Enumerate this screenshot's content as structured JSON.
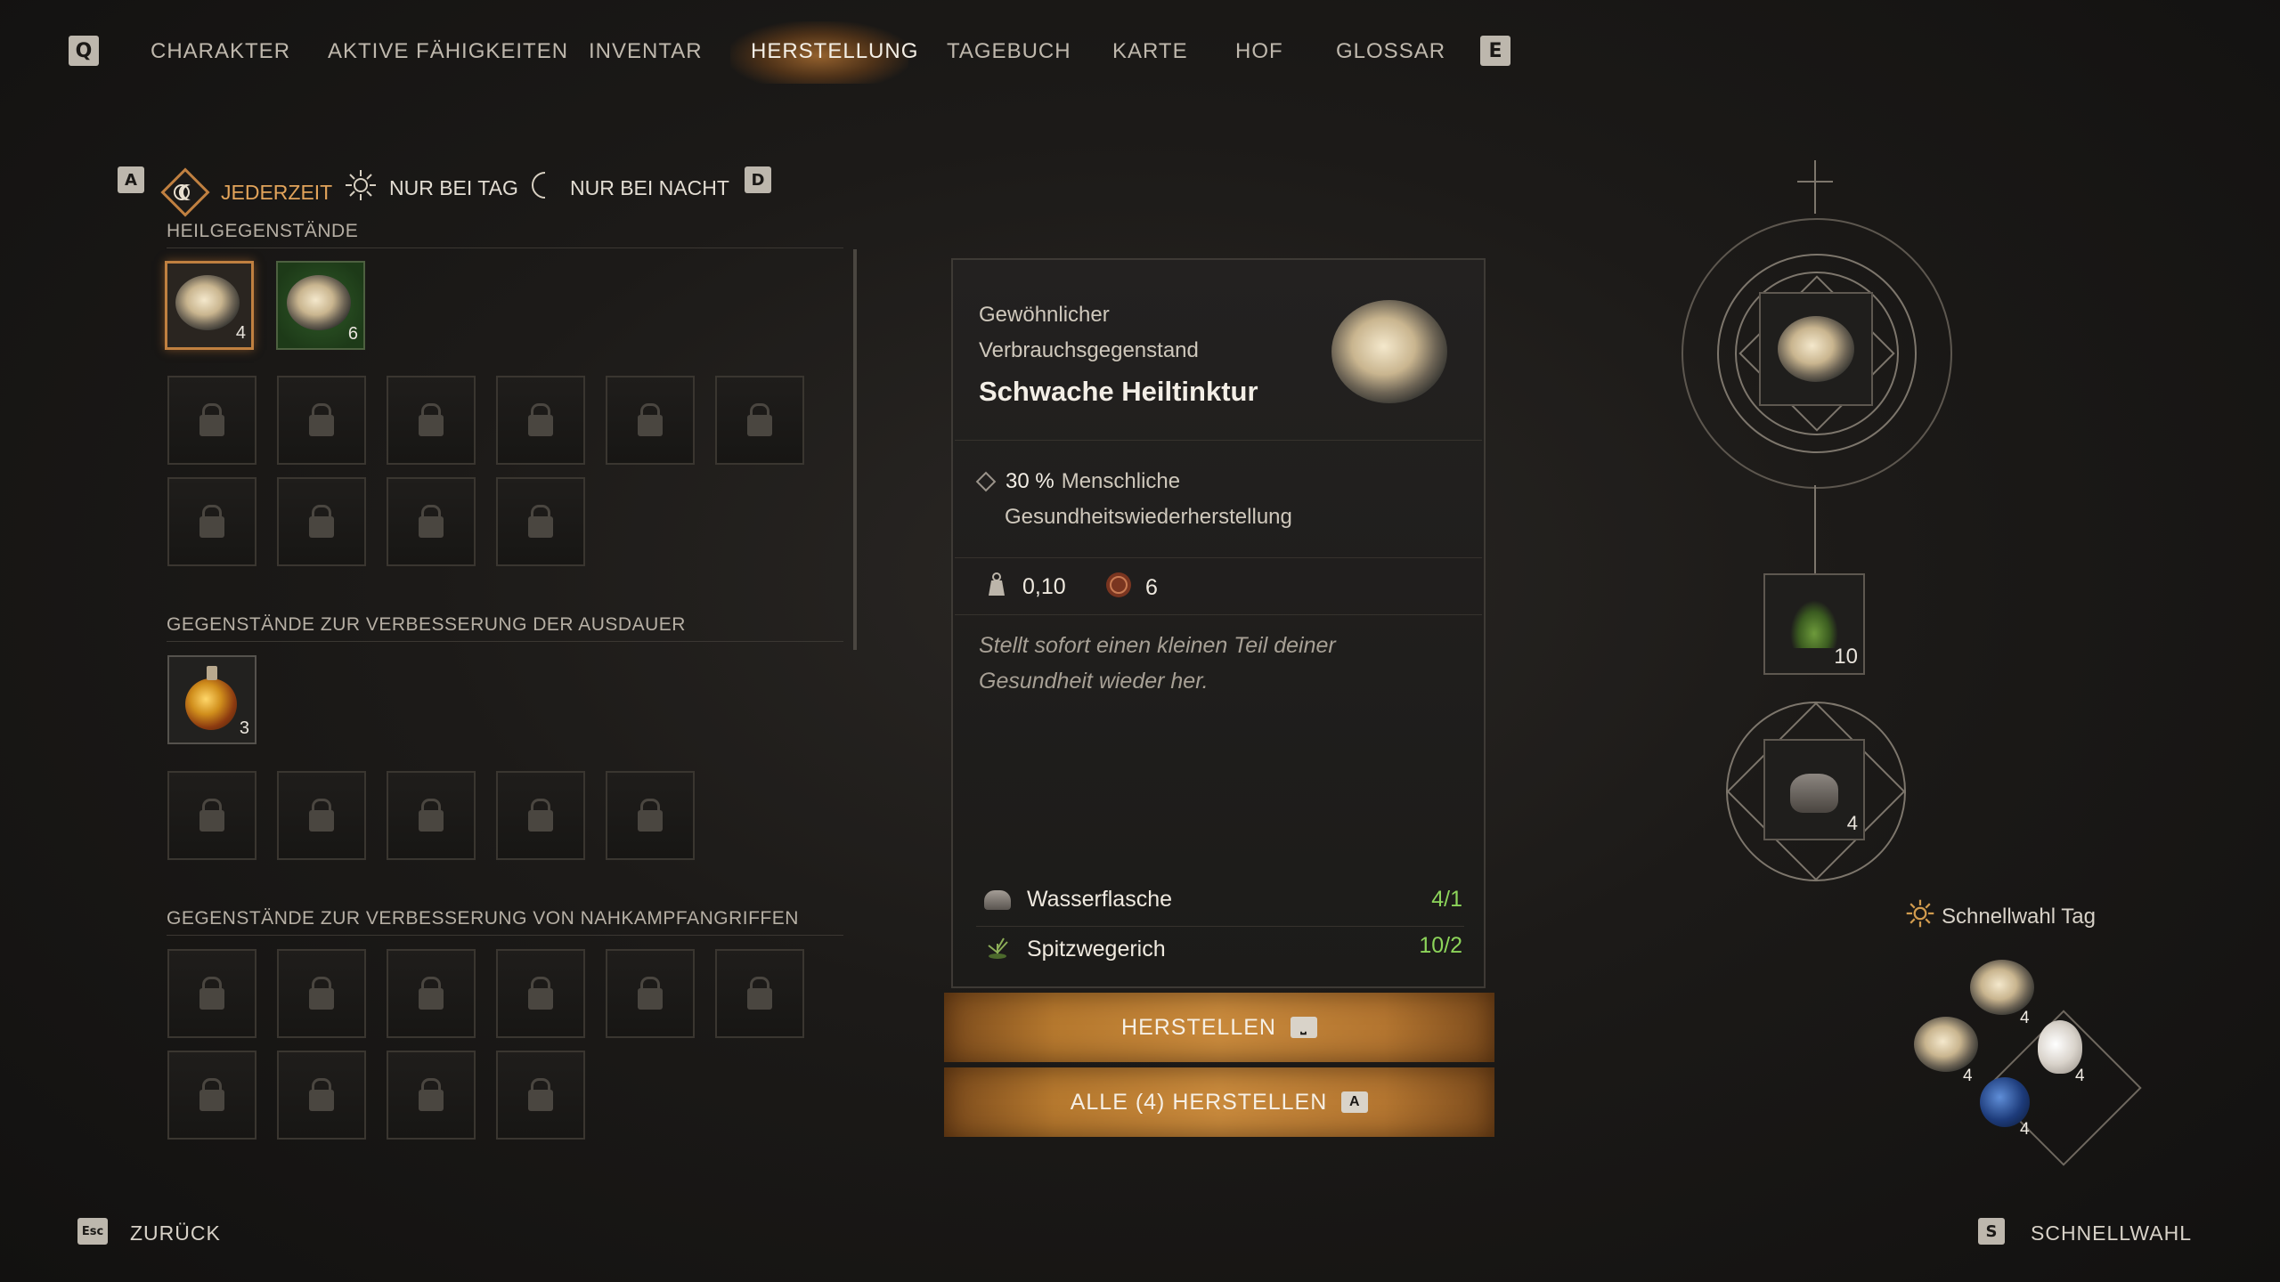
{
  "nav": {
    "left_key": "Q",
    "right_key": "E",
    "tabs": [
      "CHARAKTER",
      "AKTIVE FÄHIGKEITEN",
      "INVENTAR",
      "HERSTELLUNG",
      "TAGEBUCH",
      "KARTE",
      "HOF",
      "GLOSSAR"
    ],
    "active_tab": "HERSTELLUNG"
  },
  "filters": {
    "left_key": "A",
    "right_key": "D",
    "items": [
      "JEDERZEIT",
      "NUR BEI TAG",
      "NUR BEI NACHT"
    ],
    "active": "JEDERZEIT"
  },
  "sections": [
    {
      "title": "HEILGEGENSTÄNDE",
      "items": [
        {
          "name": "Schwache Heiltinktur",
          "count": "4",
          "selected": true
        },
        {
          "name": "Heiltinktur",
          "count": "6"
        }
      ],
      "locked": 10
    },
    {
      "title": "GEGENSTÄNDE ZUR VERBESSERUNG DER AUSDAUER",
      "items": [
        {
          "name": "Ausdauertrank",
          "count": "3"
        }
      ],
      "locked": 5
    },
    {
      "title": "GEGENSTÄNDE ZUR VERBESSERUNG VON NAHKAMPFANGRIFFEN",
      "items": [],
      "locked": 10
    }
  ],
  "detail": {
    "type_line1": "Gewöhnlicher",
    "type_line2": "Verbrauchsgegenstand",
    "name": "Schwache Heiltinktur",
    "effect_value": "30 %",
    "effect_text1": "Menschliche",
    "effect_text2": "Gesundheitswiederherstellung",
    "weight": "0,10",
    "value": "6",
    "description_line1": "Stellt sofort einen kleinen Teil deiner",
    "description_line2": "Gesundheit wieder her.",
    "ingredients": [
      {
        "name": "Wasserflasche",
        "count": "4/1"
      },
      {
        "name": "Spitzwegerich",
        "count": "10/2"
      }
    ],
    "craft_label": "HERSTELLEN",
    "craft_all_label": "ALLE (4) HERSTELLEN",
    "craft_all_key": "A"
  },
  "ornament": {
    "herb_count": "10",
    "flask_count": "4"
  },
  "quickslot": {
    "label": "Schnellwahl Tag",
    "counts": [
      "4",
      "4",
      "4",
      "4"
    ]
  },
  "bottom": {
    "back_key": "Esc",
    "back_label": "ZURÜCK",
    "quick_key": "S",
    "quick_label": "SCHNELLWAHL"
  },
  "colors": {
    "accent": "#c08040",
    "ingredient_ok": "#8cd45a"
  }
}
